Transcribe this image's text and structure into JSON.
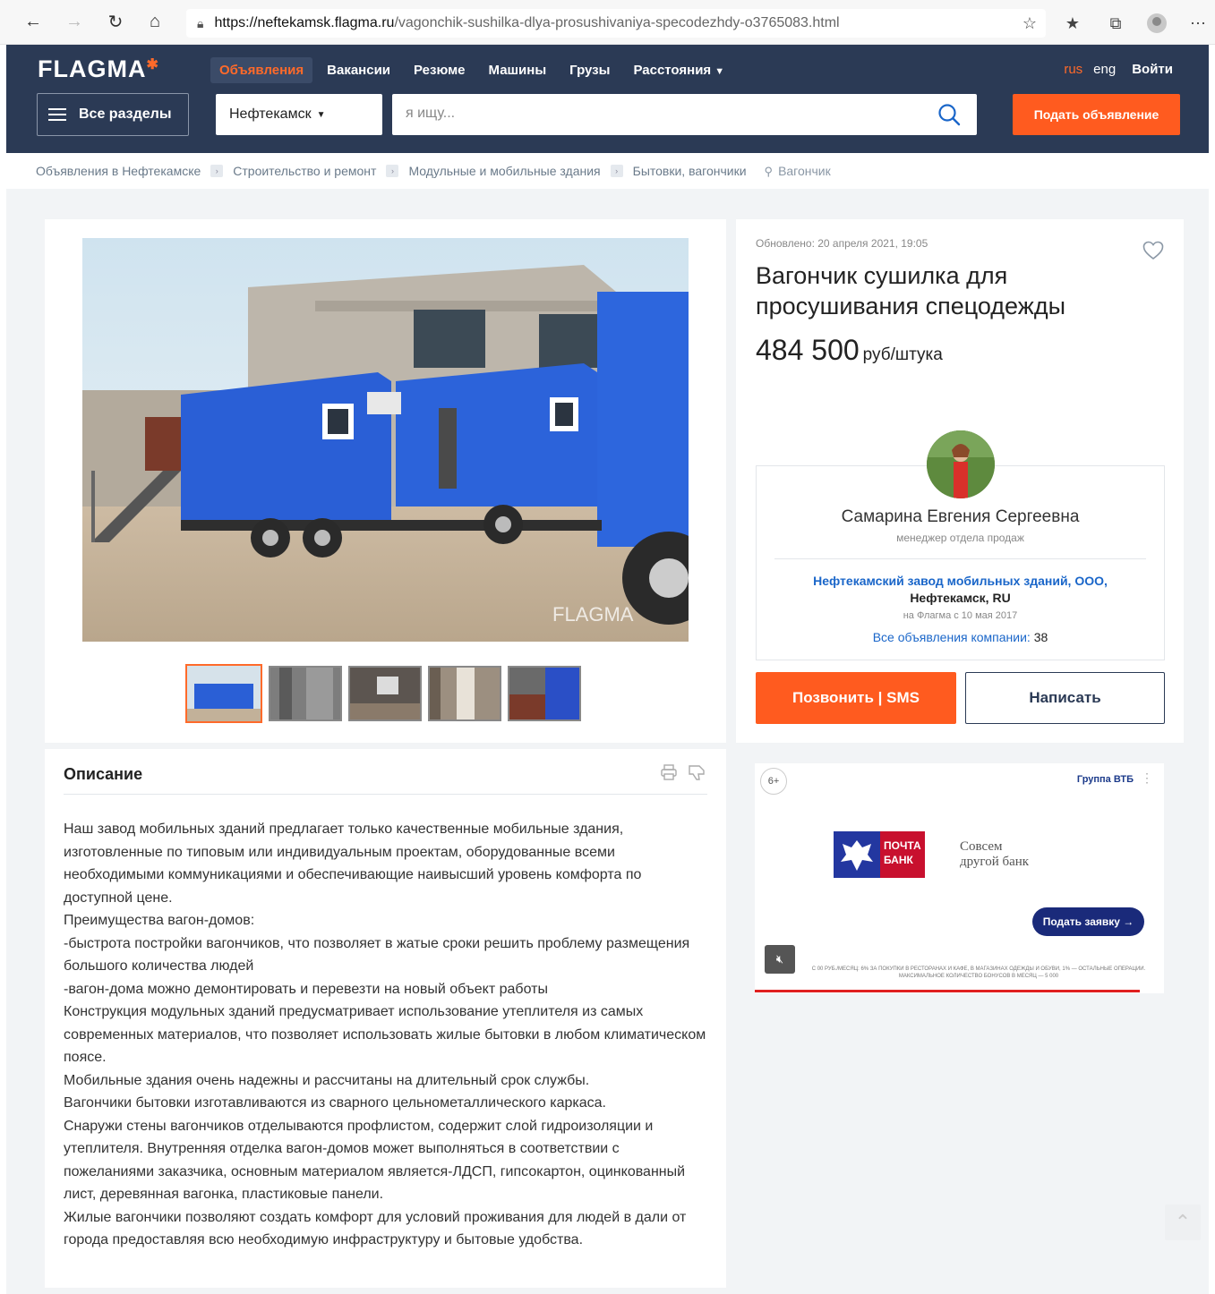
{
  "browser": {
    "url_host": "https://neftekamsk.flagma.ru",
    "url_path": "/vagonchik-sushilka-dlya-prosushivaniya-specodezhdy-o3765083.html"
  },
  "header": {
    "logo": "FLAGMA",
    "nav": [
      "Объявления",
      "Вакансии",
      "Резюме",
      "Машины",
      "Грузы",
      "Расстояния"
    ],
    "lang_rus": "rus",
    "lang_eng": "eng",
    "login": "Войти",
    "all_sections": "Все разделы",
    "city": "Нефтекамск",
    "search_placeholder": "я ищу...",
    "post_ad": "Подать объявление"
  },
  "breadcrumb": {
    "items": [
      "Объявления в Нефтекамске",
      "Строительство и ремонт",
      "Модульные и мобильные здания",
      "Бытовки, вагончики"
    ],
    "search_term": "Вагончик"
  },
  "listing": {
    "updated": "Обновлено: 20 апреля 2021, 19:05",
    "title": "Вагончик сушилка для просушивания спецодежды",
    "price": "484 500",
    "price_unit": "руб/штука",
    "watermark": "FLAGMA"
  },
  "seller": {
    "name": "Самарина Евгения Сергеевна",
    "role": "менеджер отдела продаж",
    "company": "Нефтекамский завод мобильных зданий, ООО,",
    "location": "Нефтекамск, RU",
    "since": "на Флагма с 10 мая 2017",
    "all_ads_label": "Все объявления компании:",
    "all_ads_count": "38"
  },
  "actions": {
    "call": "Позвонить | SMS",
    "write": "Написать"
  },
  "description": {
    "title": "Описание",
    "paragraphs": [
      "Наш завод мобильных зданий предлагает только качественные мобильные здания, изготовленные по типовым или индивидуальным проектам, оборудованные всеми необходимыми коммуникациями и обеспечивающие наивысший уровень комфорта по доступной цене.",
      "Преимущества вагон-домов:",
      "-быстрота постройки вагончиков, что позволяет в жатые сроки решить проблему размещения большого количества людей",
      "-вагон-дома можно демонтировать и перевезти на новый объект работы",
      "Конструкция модульных зданий предусматривает использование утеплителя из самых современных материалов, что позволяет использовать жилые бытовки в любом климатическом поясе.",
      "Мобильные здания очень надежны и рассчитаны на длительный срок службы.",
      "Вагончики бытовки изготавливаются из сварного цельнометаллического каркаса.",
      "Снаружи стены вагончиков отделываются профлистом, содержит слой гидроизоляции и утеплителя. Внутренняя отделка вагон-домов может выполняться в соответствии с пожеланиями заказчика, основным материалом является-ЛДСП, гипсокартон, оцинкованный лист, деревянная вагонка, пластиковые панели.",
      "Жилые вагончики позволяют создать комфорт для условий проживания для людей в дали от города предоставляя всю необходимую инфраструктуру и бытовые удобства."
    ]
  },
  "ad": {
    "age": "6+",
    "brand": "Группа ВТБ",
    "logo_text_1": "ПОЧТА",
    "logo_text_2": "БАНК",
    "slogan_1": "Совсем",
    "slogan_2": "другой банк",
    "apply": "Подать заявку →",
    "fine_1": "С 00 РУБ./МЕСЯЦ: 6% ЗА ПОКУПКИ В РЕСТОРАНАХ И КАФЕ, В МАГАЗИНАХ ОДЕЖДЫ И ОБУВИ, 1% — ОСТАЛЬНЫЕ ОПЕРАЦИИ.",
    "fine_2": "МАКСИМАЛЬНОЕ КОЛИЧЕСТВО БОНУСОВ В МЕСЯЦ — 5 000",
    "progress": 0.94
  },
  "colors": {
    "header_bg": "#2b3a55",
    "accent": "#ff5b1f",
    "link": "#1a66c9"
  }
}
